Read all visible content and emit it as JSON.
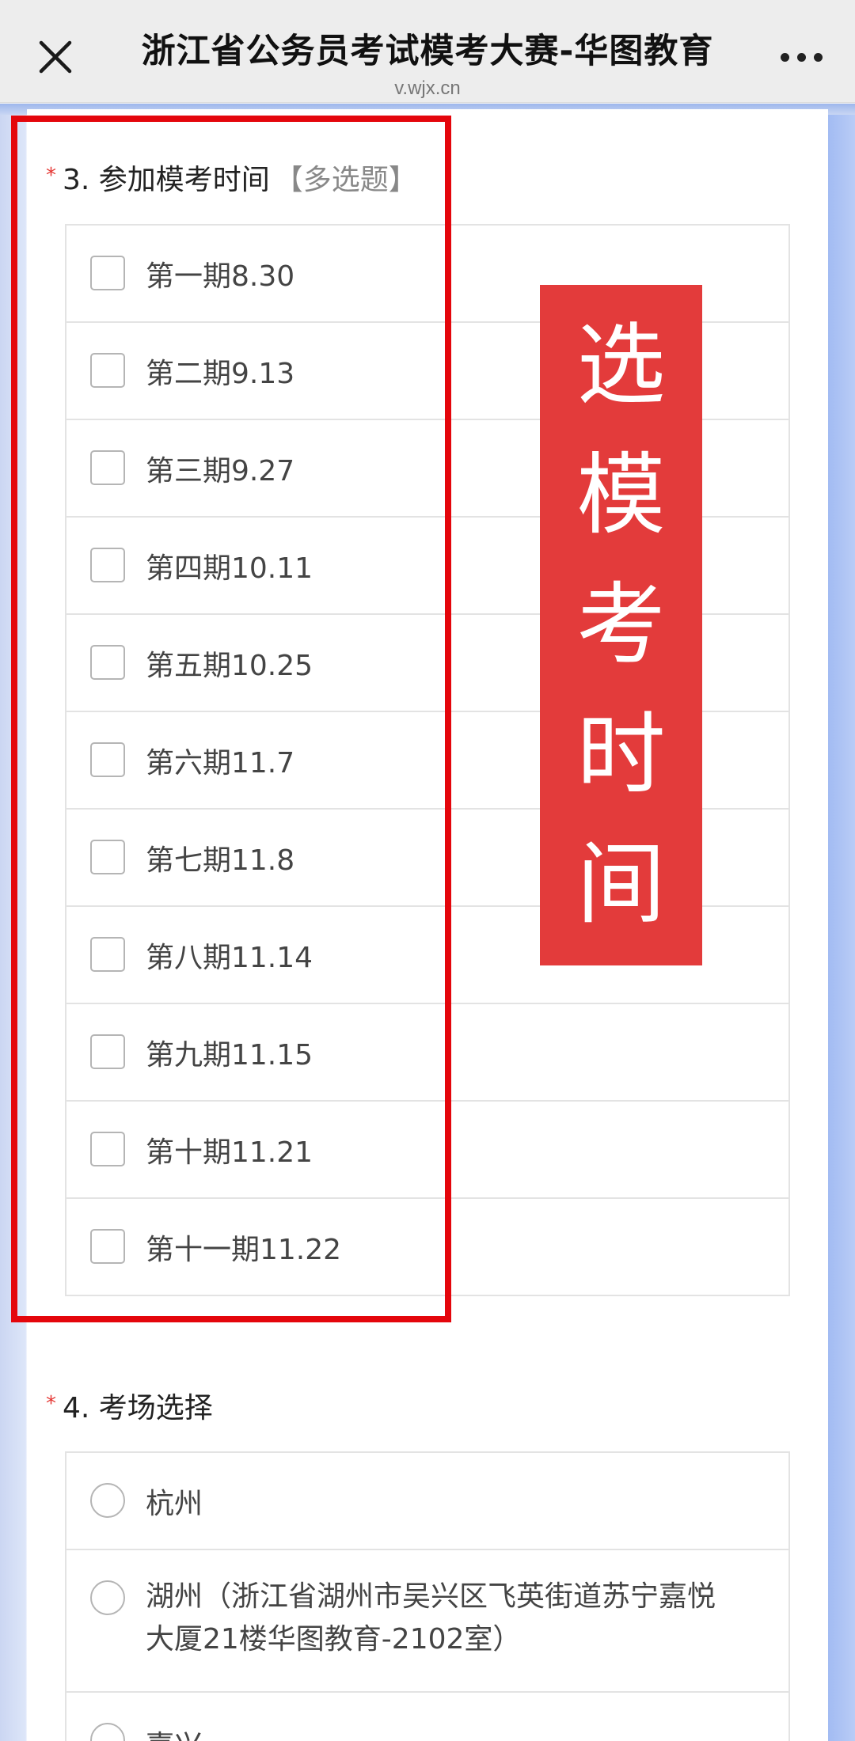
{
  "topbar": {
    "title": "浙江省公务员考试模考大赛-华图教育",
    "subtitle": "v.wjx.cn"
  },
  "question3": {
    "required_mark": "*",
    "title": "3. 参加模考时间",
    "type_label": "【多选题】",
    "options": [
      {
        "label": "第一期8.30",
        "checked": false
      },
      {
        "label": "第二期9.13",
        "checked": false
      },
      {
        "label": "第三期9.27",
        "checked": false
      },
      {
        "label": "第四期10.11",
        "checked": false
      },
      {
        "label": "第五期10.25",
        "checked": false
      },
      {
        "label": "第六期11.7",
        "checked": false
      },
      {
        "label": "第七期11.8",
        "checked": false
      },
      {
        "label": "第八期11.14",
        "checked": false
      },
      {
        "label": "第九期11.15",
        "checked": false
      },
      {
        "label": "第十期11.21",
        "checked": false
      },
      {
        "label": "第十一期11.22",
        "checked": false
      }
    ]
  },
  "question4": {
    "required_mark": "*",
    "title": "4. 考场选择",
    "options": [
      {
        "label": "杭州",
        "selected": false
      },
      {
        "label_line1": "湖州（浙江省湖州市吴兴区飞英街道苏宁嘉悦",
        "label_line2": "大厦21楼华图教育-2102室）",
        "selected": false
      },
      {
        "label": "嘉兴",
        "selected": false
      }
    ]
  },
  "annotation": {
    "banner_chars": [
      "选",
      "模",
      "考",
      "时",
      "间"
    ],
    "banner_color": "#e33b3b",
    "box_color": "#e4060c"
  },
  "colors": {
    "required": "#e53935",
    "side_gradient_right": "#9fb9f2"
  }
}
